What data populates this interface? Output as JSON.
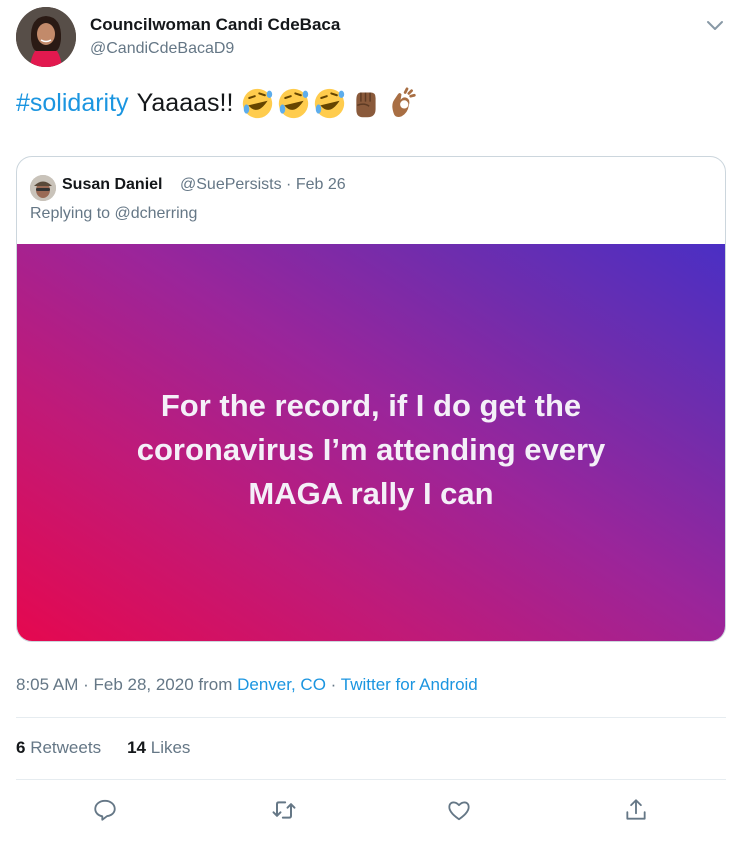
{
  "author": {
    "name": "Councilwoman Candi CdeBaca",
    "handle": "@CandiCdeBacaD9"
  },
  "tweet": {
    "hashtag": "#solidarity",
    "text": "Yaaaas!!",
    "emojis": [
      "rolling-on-floor-laughing",
      "rolling-on-floor-laughing",
      "rolling-on-floor-laughing",
      "raised-fist-medium-dark",
      "ok-hand-medium-dark"
    ]
  },
  "quote": {
    "name": "Susan Daniel",
    "handle": "@SuePersists · Feb 26",
    "replying": "Replying to @dcherring",
    "image_lines": [
      "For the record, if I do get the",
      "coronavirus I’m attending every",
      "MAGA rally I can"
    ]
  },
  "meta": {
    "time": "8:05 AM · Feb 28, 2020 from ",
    "location": "Denver, CO",
    "separator": " · ",
    "source": "Twitter for Android"
  },
  "stats": {
    "retweets_count": "6",
    "retweets_label": "Retweets",
    "likes_count": "14",
    "likes_label": "Likes"
  },
  "colors": {
    "link": "#1b95e0",
    "muted": "#657786",
    "text": "#14171a"
  },
  "icons": [
    "chevron-down-icon",
    "reply-icon",
    "retweet-icon",
    "like-icon",
    "share-icon"
  ]
}
